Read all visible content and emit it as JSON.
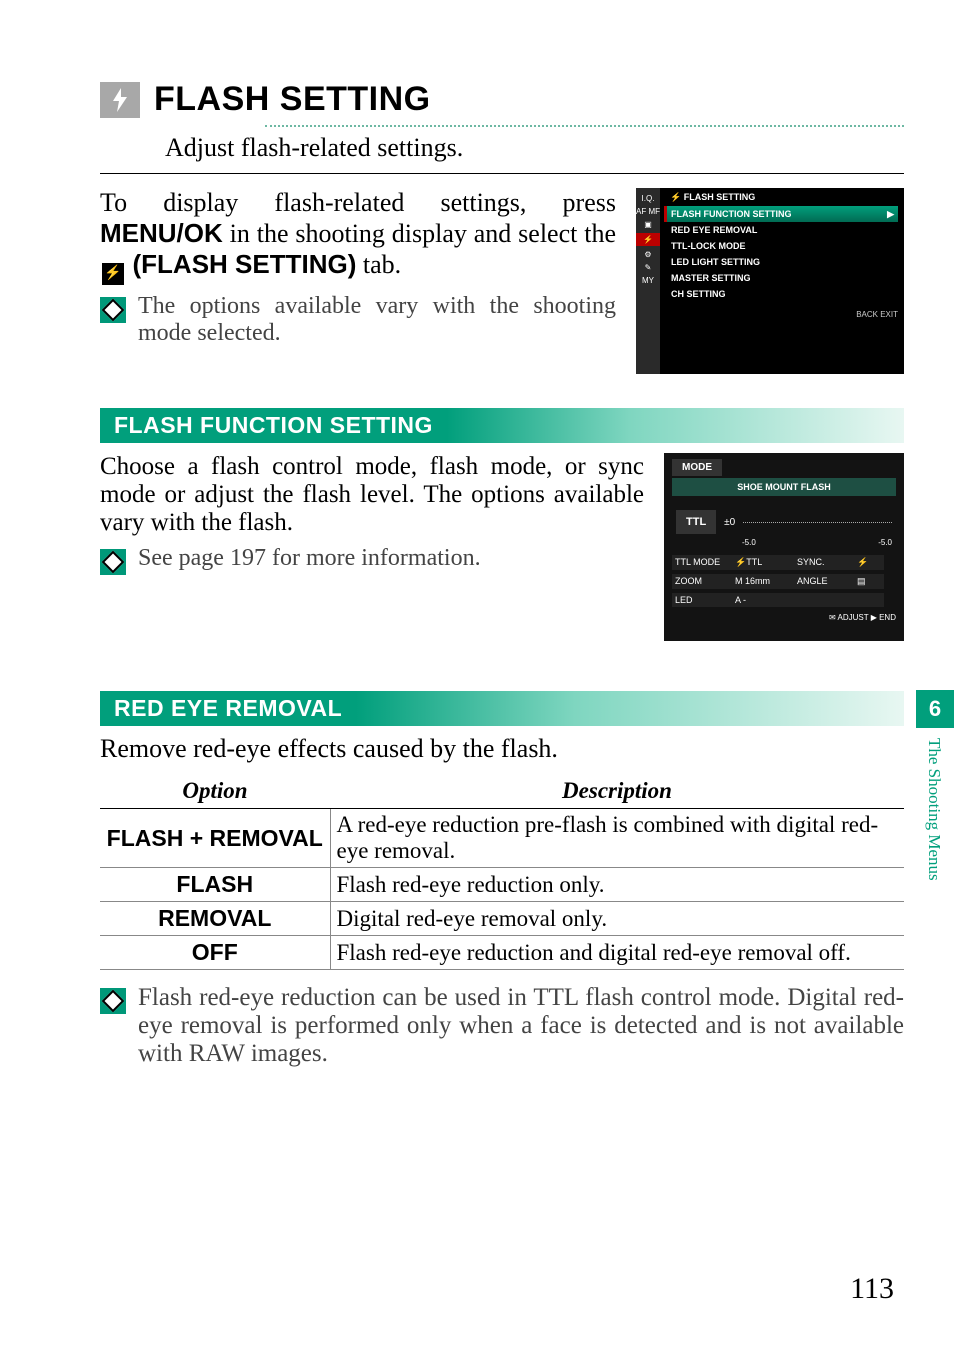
{
  "header": {
    "title": "FLASH SETTING",
    "subtitle": "Adjust flash-related settings."
  },
  "intro": {
    "p1a": "To display flash-related settings, press ",
    "p1b": "MENU/OK",
    "p1c": " in the shooting display and select the ",
    "p1d": "(FLASH SETTING)",
    "p1e": " tab.",
    "note": "The options available vary with the shooting mode selected."
  },
  "cam_menu": {
    "title": "FLASH SETTING",
    "tabs": [
      "I.Q.",
      "AF MF",
      "",
      "⚡",
      "",
      "",
      "MY"
    ],
    "items": [
      "FLASH FUNCTION SETTING",
      "RED EYE REMOVAL",
      "TTL-LOCK MODE",
      "LED LIGHT SETTING",
      "MASTER SETTING",
      "CH SETTING"
    ],
    "footer": "BACK  EXIT"
  },
  "section_ffs": {
    "heading": "FLASH FUNCTION SETTING",
    "para": "Choose a flash control mode, flash mode, or sync mode or adjust the flash level. The options available vary with the flash.",
    "note": "See page 197 for more information.",
    "shot": {
      "mode": "MODE",
      "shoe": "SHOE MOUNT FLASH",
      "ttl": "TTL",
      "val": "±0",
      "scale_lo": "-5.0",
      "scale_hi": "-5.0",
      "rows": [
        [
          "TTL MODE",
          "⚡TTL",
          "SYNC.",
          "⚡"
        ],
        [
          "ZOOM",
          "M  16mm",
          "ANGLE",
          "▤"
        ],
        [
          "LED",
          "A -",
          "",
          ""
        ]
      ],
      "foot": "✉  ADJUST   ▶  END"
    }
  },
  "section_rer": {
    "heading": "RED EYE REMOVAL",
    "lead": "Remove red-eye effects caused by the flash.",
    "table": {
      "headers": [
        "Option",
        "Description"
      ],
      "rows": [
        [
          "FLASH + REMOVAL",
          "A red-eye reduction pre-flash is combined with digital red-eye removal."
        ],
        [
          "FLASH",
          "Flash red-eye reduction only."
        ],
        [
          "REMOVAL",
          "Digital red-eye removal only."
        ],
        [
          "OFF",
          "Flash red-eye reduction and digital red-eye removal off."
        ]
      ]
    },
    "note": "Flash red-eye reduction can be used in TTL flash control mode. Digital red-eye removal is performed only when a face is detected and is not available with RAW images."
  },
  "sidebar": {
    "chapter_num": "6",
    "chapter_label": "The Shooting Menus"
  },
  "page_number": "113"
}
